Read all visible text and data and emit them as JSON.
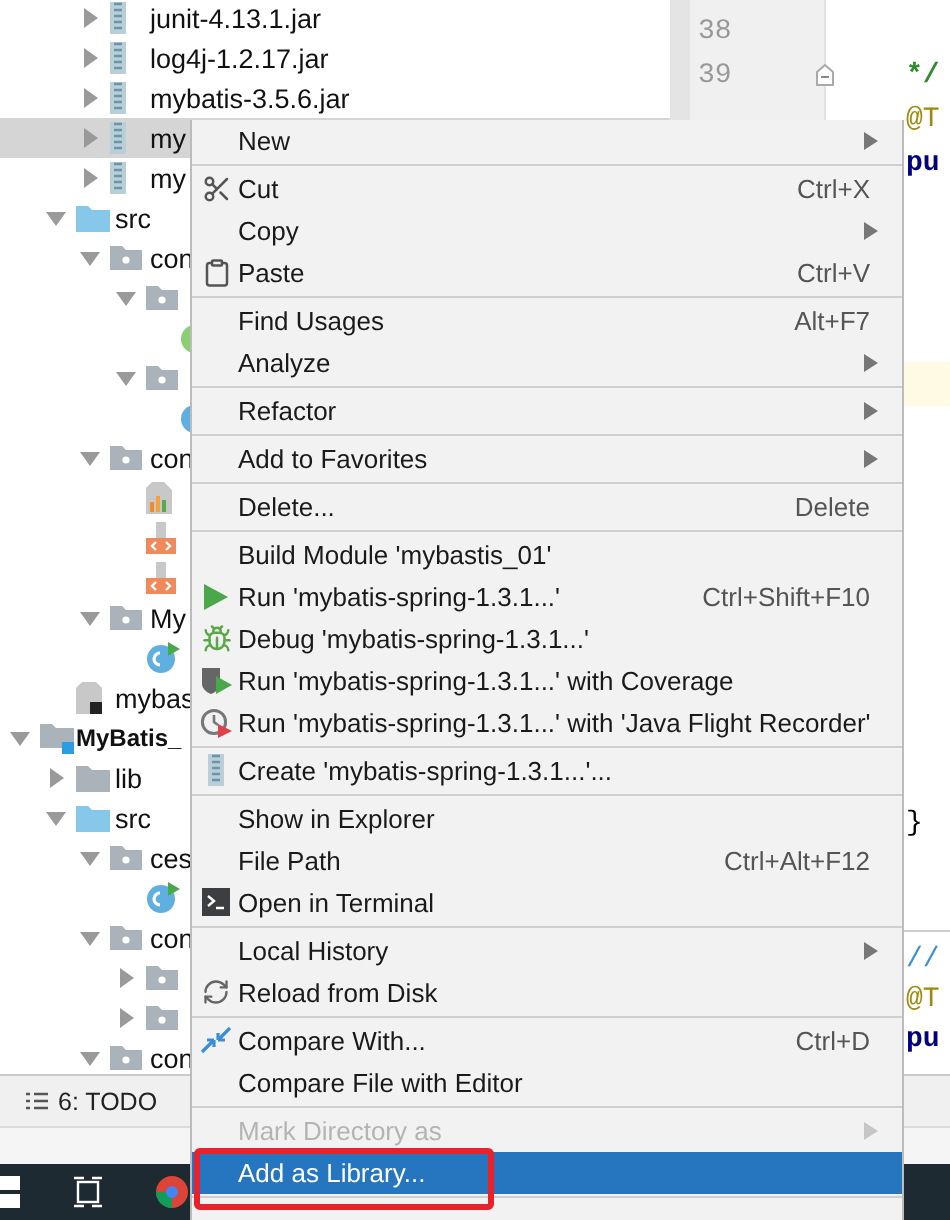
{
  "tree": [
    {
      "children": [
        {
          "children": [
            {
              "label": "junit-4.13.1.jar",
              "kind": "jar",
              "expanded": false,
              "selected": false
            },
            {
              "label": "log4j-1.2.17.jar",
              "kind": "jar",
              "expanded": false,
              "selected": false
            },
            {
              "label": "mybatis-3.5.6.jar",
              "kind": "jar",
              "expanded": false,
              "selected": false
            },
            {
              "label": "my",
              "kind": "jar",
              "expanded": false,
              "selected": true
            },
            {
              "label": "my",
              "kind": "jar",
              "expanded": false,
              "selected": false
            }
          ]
        },
        {
          "label": "src",
          "kind": "source",
          "expanded": true,
          "selected": false,
          "children": [
            {
              "label": "con",
              "kind": "package",
              "expanded": true,
              "selected": false,
              "children": [
                {
                  "kind": "package",
                  "expanded": true,
                  "selected": false,
                  "children": [
                    {
                      "kind": "test",
                      "selected": false
                    }
                  ]
                },
                {
                  "kind": "package",
                  "expanded": true,
                  "selected": false,
                  "children": [
                    {
                      "kind": "class",
                      "selected": false
                    }
                  ]
                }
              ]
            },
            {
              "label": "con",
              "kind": "package",
              "expanded": true,
              "selected": false,
              "children": [
                {
                  "kind": "chart",
                  "selected": false
                },
                {
                  "kind": "xml",
                  "selected": false
                },
                {
                  "kind": "xml",
                  "selected": false
                }
              ]
            },
            {
              "label": "My",
              "kind": "package",
              "expanded": true,
              "selected": false,
              "children": [
                {
                  "kind": "runnable",
                  "selected": false
                }
              ]
            }
          ]
        },
        {
          "label": "mybas",
          "kind": "file",
          "selected": false
        }
      ]
    },
    {
      "label": "MyBatis_",
      "kind": "module",
      "expanded": true,
      "selected": false,
      "children": [
        {
          "label": "lib",
          "kind": "folder",
          "expanded": false,
          "selected": false
        },
        {
          "label": "src",
          "kind": "source",
          "expanded": true,
          "selected": false,
          "children": [
            {
              "label": "ces",
              "kind": "package",
              "expanded": true,
              "selected": false,
              "children": [
                {
                  "kind": "runnable",
                  "selected": false
                }
              ]
            },
            {
              "label": "con",
              "kind": "package",
              "expanded": true,
              "selected": false,
              "children": [
                {
                  "kind": "package",
                  "expanded": false,
                  "selected": false
                },
                {
                  "kind": "package",
                  "expanded": false,
                  "selected": false
                }
              ]
            },
            {
              "label": "con",
              "kind": "package",
              "expanded": true,
              "selected": false
            }
          ]
        }
      ]
    }
  ],
  "gutter": {
    "line_numbers": [
      "38",
      "39"
    ]
  },
  "editor": {
    "lines": [
      {
        "kind": "blank"
      },
      {
        "kind": "comment",
        "text": "*/"
      },
      {
        "kind": "annotation",
        "text": "@T"
      },
      {
        "kind": "keyword",
        "text": "pu"
      },
      {
        "kind": "blank"
      },
      {
        "kind": "blank"
      },
      {
        "kind": "blank"
      },
      {
        "kind": "blank"
      },
      {
        "kind": "current"
      },
      {
        "kind": "blank"
      },
      {
        "kind": "blank"
      },
      {
        "kind": "blank"
      },
      {
        "kind": "blank"
      },
      {
        "kind": "blank"
      },
      {
        "kind": "blank"
      },
      {
        "kind": "blank"
      },
      {
        "kind": "blank"
      },
      {
        "kind": "blank"
      },
      {
        "kind": "brace",
        "text": "}"
      }
    ]
  },
  "editor_lower": {
    "lines": [
      {
        "kind": "doc",
        "text": "//"
      },
      {
        "kind": "annotation",
        "text": "@T"
      },
      {
        "kind": "keyword",
        "text": "pu"
      }
    ]
  },
  "tool_bar": {
    "tabs": [
      {
        "label": "6: TODO",
        "selected": false
      }
    ]
  },
  "context_menu": {
    "items": [
      {
        "kind": "plain",
        "label": "New",
        "submenu": true,
        "selected": false,
        "disabled": false
      },
      {
        "kind": "separator"
      },
      {
        "kind": "scissors",
        "label": "Cut",
        "shortcut": "Ctrl+X",
        "submenu": false,
        "selected": false,
        "disabled": false
      },
      {
        "kind": "plain",
        "label": "Copy",
        "submenu": true,
        "selected": false,
        "disabled": false
      },
      {
        "kind": "clipboard",
        "label": "Paste",
        "shortcut": "Ctrl+V",
        "submenu": false,
        "selected": false,
        "disabled": false
      },
      {
        "kind": "separator"
      },
      {
        "kind": "plain",
        "label": "Find Usages",
        "shortcut": "Alt+F7",
        "submenu": false,
        "selected": false,
        "disabled": false
      },
      {
        "kind": "plain",
        "label": "Analyze",
        "submenu": true,
        "selected": false,
        "disabled": false
      },
      {
        "kind": "separator"
      },
      {
        "kind": "plain",
        "label": "Refactor",
        "submenu": true,
        "selected": false,
        "disabled": false
      },
      {
        "kind": "separator"
      },
      {
        "kind": "plain",
        "label": "Add to Favorites",
        "submenu": true,
        "selected": false,
        "disabled": false
      },
      {
        "kind": "separator"
      },
      {
        "kind": "plain",
        "label": "Delete...",
        "shortcut": "Delete",
        "submenu": false,
        "selected": false,
        "disabled": false
      },
      {
        "kind": "separator"
      },
      {
        "kind": "plain",
        "label": "Build Module 'mybastis_01'",
        "submenu": false,
        "selected": false,
        "disabled": false
      },
      {
        "kind": "run",
        "label": "Run 'mybatis-spring-1.3.1...'",
        "shortcut": "Ctrl+Shift+F10",
        "submenu": false,
        "selected": false,
        "disabled": false
      },
      {
        "kind": "debug",
        "label": "Debug 'mybatis-spring-1.3.1...'",
        "submenu": false,
        "selected": false,
        "disabled": false
      },
      {
        "kind": "coverage",
        "label": "Run 'mybatis-spring-1.3.1...' with Coverage",
        "submenu": false,
        "selected": false,
        "disabled": false
      },
      {
        "kind": "profiler",
        "label": "Run 'mybatis-spring-1.3.1...' with 'Java Flight Recorder'",
        "submenu": false,
        "selected": false,
        "disabled": false
      },
      {
        "kind": "separator"
      },
      {
        "kind": "jar",
        "label": "Create 'mybatis-spring-1.3.1...'...",
        "submenu": false,
        "selected": false,
        "disabled": false
      },
      {
        "kind": "separator"
      },
      {
        "kind": "plain",
        "label": "Show in Explorer",
        "submenu": false,
        "selected": false,
        "disabled": false
      },
      {
        "kind": "plain",
        "label": "File Path",
        "shortcut": "Ctrl+Alt+F12",
        "submenu": false,
        "selected": false,
        "disabled": false
      },
      {
        "kind": "terminal",
        "label": "Open in Terminal",
        "submenu": false,
        "selected": false,
        "disabled": false
      },
      {
        "kind": "separator"
      },
      {
        "kind": "plain",
        "label": "Local History",
        "submenu": true,
        "selected": false,
        "disabled": false
      },
      {
        "kind": "reload",
        "label": "Reload from Disk",
        "submenu": false,
        "selected": false,
        "disabled": false
      },
      {
        "kind": "separator"
      },
      {
        "kind": "compare",
        "label": "Compare With...",
        "shortcut": "Ctrl+D",
        "submenu": false,
        "selected": false,
        "disabled": false
      },
      {
        "kind": "plain",
        "label": "Compare File with Editor",
        "submenu": false,
        "selected": false,
        "disabled": false
      },
      {
        "kind": "separator"
      },
      {
        "kind": "plain",
        "label": "Mark Directory as",
        "submenu": true,
        "selected": false,
        "disabled": true
      },
      {
        "kind": "plain",
        "label": "Add as Library...",
        "submenu": false,
        "selected": true,
        "disabled": false
      },
      {
        "kind": "separator"
      }
    ]
  },
  "red_frame": {
    "shown": true
  }
}
